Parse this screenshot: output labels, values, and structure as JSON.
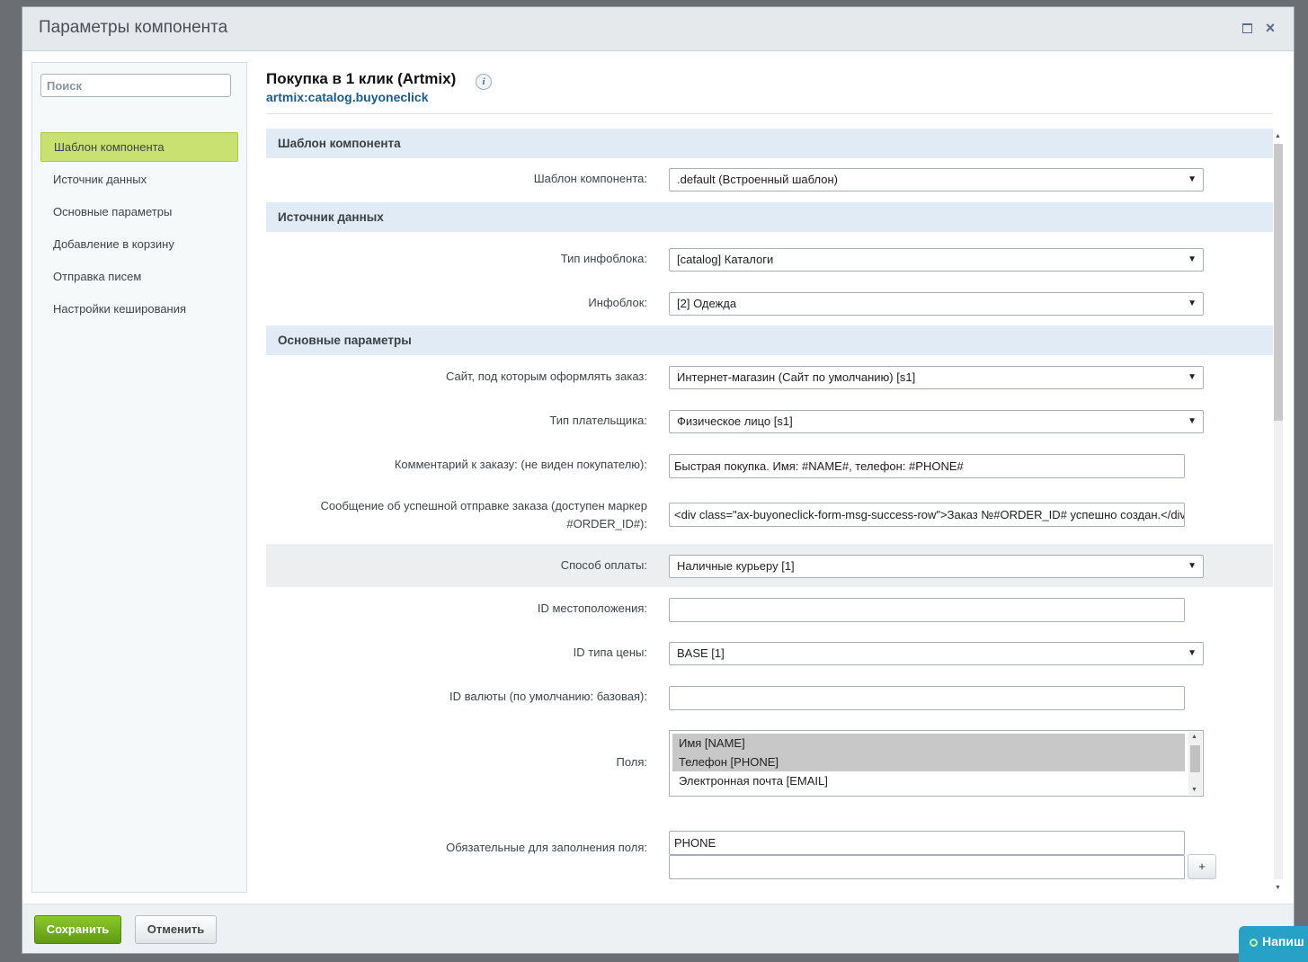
{
  "window": {
    "title": "Параметры компонента",
    "maximize_icon": "maximize-icon",
    "close_glyph": "×"
  },
  "sidebar": {
    "search_placeholder": "Поиск",
    "items": [
      {
        "label": "Шаблон компонента",
        "active": true
      },
      {
        "label": "Источник данных"
      },
      {
        "label": "Основные параметры"
      },
      {
        "label": "Добавление в корзину"
      },
      {
        "label": "Отправка писем"
      },
      {
        "label": "Настройки кеширования"
      }
    ]
  },
  "component": {
    "title": "Покупка в 1 клик (Artmix)",
    "info_glyph": "i",
    "id": "artmix:catalog.buyoneclick"
  },
  "sections": {
    "template": {
      "title": "Шаблон компонента",
      "template_label": "Шаблон компонента:",
      "template_value": ".default (Встроенный шаблон)"
    },
    "source": {
      "title": "Источник данных",
      "iblock_type_label": "Тип инфоблока:",
      "iblock_type_value": "[catalog] Каталоги",
      "iblock_label": "Инфоблок:",
      "iblock_value": "[2] Одежда"
    },
    "main": {
      "title": "Основные параметры",
      "site_label": "Сайт, под которым оформлять заказ:",
      "site_value": "Интернет-магазин (Сайт по умолчанию) [s1]",
      "payer_label": "Тип плательщика:",
      "payer_value": "Физическое лицо [s1]",
      "comment_label": "Комментарий к заказу: (не виден покупателю):",
      "comment_value": "Быстрая покупка. Имя: #NAME#, телефон: #PHONE#",
      "success_label_1": "Сообщение об успешной отправке заказа (доступен маркер",
      "success_label_2": "#ORDER_ID#):",
      "success_value": "<div class=\"ax-buyoneclick-form-msg-success-row\">Заказ №#ORDER_ID# успешно создан.</div>",
      "payment_label": "Способ оплаты:",
      "payment_value": "Наличные курьеру [1]",
      "location_label": "ID местоположения:",
      "location_value": "",
      "price_label": "ID типа цены:",
      "price_value": "BASE [1]",
      "currency_label": "ID валюты (по умолчанию: базовая):",
      "currency_value": "",
      "fields_label": "Поля:",
      "fields_options": [
        {
          "label": "Имя [NAME]",
          "selected": true
        },
        {
          "label": "Телефон [PHONE]",
          "selected": true
        },
        {
          "label": "Электронная почта [EMAIL]",
          "selected": false
        }
      ],
      "required_label": "Обязательные для заполнения поля:",
      "required_values": [
        "PHONE",
        ""
      ],
      "plus_label": "+"
    }
  },
  "footer": {
    "save_label": "Сохранить",
    "cancel_label": "Отменить"
  },
  "chat": {
    "label": "Напиш"
  },
  "colors": {
    "accent_green": "#8bc82d",
    "active_nav": "#c9e170",
    "section_bg": "#e1ebf5",
    "link_blue": "#1e5b83",
    "chat_bg": "#27a1c6"
  }
}
